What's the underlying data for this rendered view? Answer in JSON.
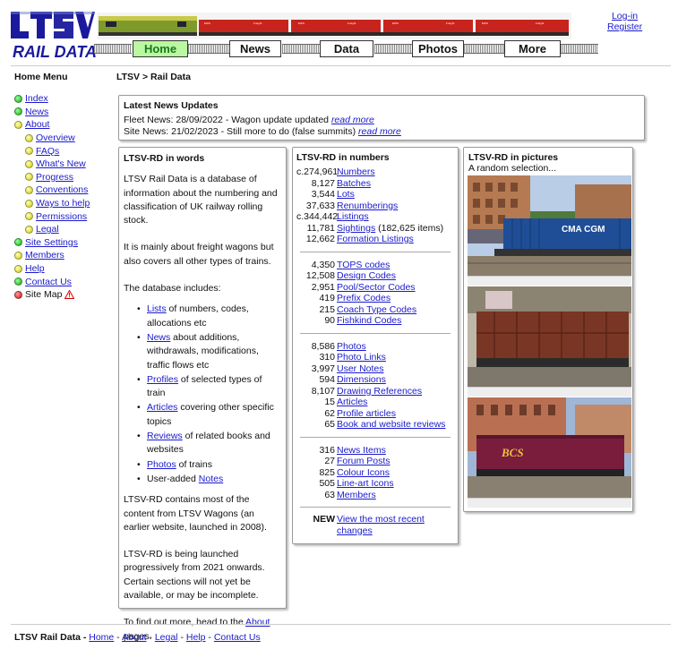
{
  "header": {
    "logo_text": "RAIL DATA",
    "nav": [
      "Home",
      "News",
      "Data",
      "Photos",
      "More"
    ],
    "login": "Log-in",
    "register": "Register"
  },
  "home_menu": {
    "title": "Home Menu",
    "items": [
      {
        "label": "Index",
        "dot": "g",
        "indent": 0,
        "link": true
      },
      {
        "label": "News",
        "dot": "g",
        "indent": 0,
        "link": true
      },
      {
        "label": "About",
        "dot": "y",
        "indent": 0,
        "link": true
      },
      {
        "label": "Overview",
        "dot": "y",
        "indent": 1,
        "link": true
      },
      {
        "label": "FAQs",
        "dot": "y",
        "indent": 1,
        "link": true
      },
      {
        "label": "What's New",
        "dot": "y",
        "indent": 1,
        "link": true
      },
      {
        "label": "Progress",
        "dot": "y",
        "indent": 1,
        "link": true
      },
      {
        "label": "Conventions",
        "dot": "y",
        "indent": 1,
        "link": true
      },
      {
        "label": "Ways to help",
        "dot": "y",
        "indent": 1,
        "link": true
      },
      {
        "label": "Permissions",
        "dot": "y",
        "indent": 1,
        "link": true
      },
      {
        "label": "Legal",
        "dot": "y",
        "indent": 1,
        "link": true
      },
      {
        "label": "Site Settings",
        "dot": "g",
        "indent": 0,
        "link": true
      },
      {
        "label": "Members",
        "dot": "y",
        "indent": 0,
        "link": true
      },
      {
        "label": "Help",
        "dot": "y",
        "indent": 0,
        "link": true
      },
      {
        "label": "Contact Us",
        "dot": "g",
        "indent": 0,
        "link": true
      },
      {
        "label": "Site Map",
        "dot": "r",
        "indent": 0,
        "link": false
      }
    ]
  },
  "breadcrumb": "LTSV > Rail Data",
  "news": {
    "title": "Latest News Updates",
    "lines": [
      {
        "text": "Fleet News: 28/09/2022 - Wagon update updated ",
        "link": "read more"
      },
      {
        "text": "Site News: 21/02/2023 - Still more to do (false summits) ",
        "link": "read more"
      }
    ]
  },
  "words": {
    "title": "LTSV-RD in words",
    "p1": "LTSV Rail Data is a database of information about the numbering and classification of UK railway rolling stock.",
    "p2": "It is mainly about freight wagons but also covers all other types of trains.",
    "p3": "The database includes:",
    "list": [
      {
        "link": "Lists",
        "rest": " of numbers, codes, allocations etc"
      },
      {
        "link": "News",
        "rest": " about additions, withdrawals, modifications, traffic flows etc"
      },
      {
        "link": "Profiles",
        "rest": " of selected types of train"
      },
      {
        "link": "Articles",
        "rest": " covering other specific topics"
      },
      {
        "link": "Reviews",
        "rest": " of related books and websites"
      },
      {
        "link": "Photos",
        "rest": " of trains"
      },
      {
        "pre": "User-added ",
        "link": "Notes",
        "rest": ""
      }
    ],
    "p4": "LTSV-RD contains most of the content from LTSV Wagons (an earlier website, launched in 2008).",
    "p5": "LTSV-RD is being launched progressively from 2021 onwards. Certain sections will not yet be available, or may be incomplete.",
    "p6a": "To find out more, head to the ",
    "p6link": "About",
    "p6b": " pages."
  },
  "numbers": {
    "title": "LTSV-RD in numbers",
    "groups": [
      [
        {
          "n": "c.274,961",
          "l": "Numbers"
        },
        {
          "n": "8,127",
          "l": "Batches"
        },
        {
          "n": "3,544",
          "l": "Lots"
        },
        {
          "n": "37,633",
          "l": "Renumberings"
        },
        {
          "n": "c.344,442",
          "l": "Listings"
        },
        {
          "n": "11,781",
          "l": "Sightings",
          "x": " (182,625 items)"
        },
        {
          "n": "12,662",
          "l": "Formation Listings"
        }
      ],
      [
        {
          "n": "4,350",
          "l": "TOPS codes"
        },
        {
          "n": "12,508",
          "l": "Design Codes"
        },
        {
          "n": "2,951",
          "l": "Pool/Sector Codes"
        },
        {
          "n": "419",
          "l": "Prefix Codes"
        },
        {
          "n": "215",
          "l": "Coach Type Codes"
        },
        {
          "n": "90",
          "l": "Fishkind Codes"
        }
      ],
      [
        {
          "n": "8,586",
          "l": "Photos"
        },
        {
          "n": "310",
          "l": "Photo Links"
        },
        {
          "n": "3,997",
          "l": "User Notes"
        },
        {
          "n": "594",
          "l": "Dimensions"
        },
        {
          "n": "8,107",
          "l": "Drawing References"
        },
        {
          "n": "15",
          "l": "Articles"
        },
        {
          "n": "62",
          "l": "Profile articles"
        },
        {
          "n": "65",
          "l": "Book and website reviews"
        }
      ],
      [
        {
          "n": "316",
          "l": "News Items"
        },
        {
          "n": "27",
          "l": "Forum Posts"
        },
        {
          "n": "825",
          "l": "Colour Icons"
        },
        {
          "n": "505",
          "l": "Line-art Icons"
        },
        {
          "n": "63",
          "l": "Members"
        }
      ]
    ],
    "new_label": "NEW",
    "new_link": "View the most recent changes"
  },
  "pictures": {
    "title": "LTSV-RD in pictures",
    "subtitle": "A random selection...",
    "container_text": "CMA CGM",
    "wagon_text": "BCS"
  },
  "footer": {
    "title": "LTSV Rail Data - ",
    "links": [
      "Home",
      "About",
      "Legal",
      "Help",
      "Contact Us"
    ]
  }
}
